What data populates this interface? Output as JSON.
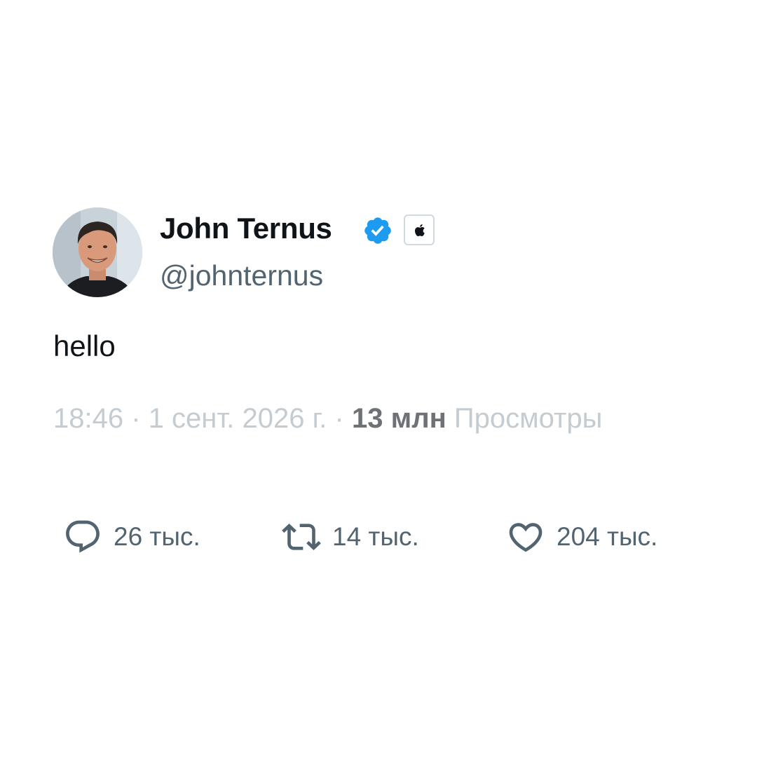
{
  "author": {
    "display_name": "John Ternus",
    "handle": "@johnternus",
    "verified_icon": "verified-badge-icon",
    "affiliate_icon": "apple-logo-icon",
    "verified_color": "#1d9bf0"
  },
  "tweet": {
    "text": "hello"
  },
  "meta": {
    "time": "18:46",
    "separator": "·",
    "date": "1 сент. 2026 г.",
    "views_count": "13 млн",
    "views_label": "Просмотры"
  },
  "actions": {
    "reply": {
      "icon": "reply-bubble-icon",
      "count": "26 тыс."
    },
    "retweet": {
      "icon": "retweet-icon",
      "count": "14 тыс."
    },
    "like": {
      "icon": "heart-icon",
      "count": "204 тыс."
    }
  },
  "colors": {
    "text_primary": "#0f1419",
    "text_secondary": "#536471",
    "meta_light": "#c4ccd2",
    "meta_bold": "#6e7175",
    "background": "#ffffff"
  }
}
